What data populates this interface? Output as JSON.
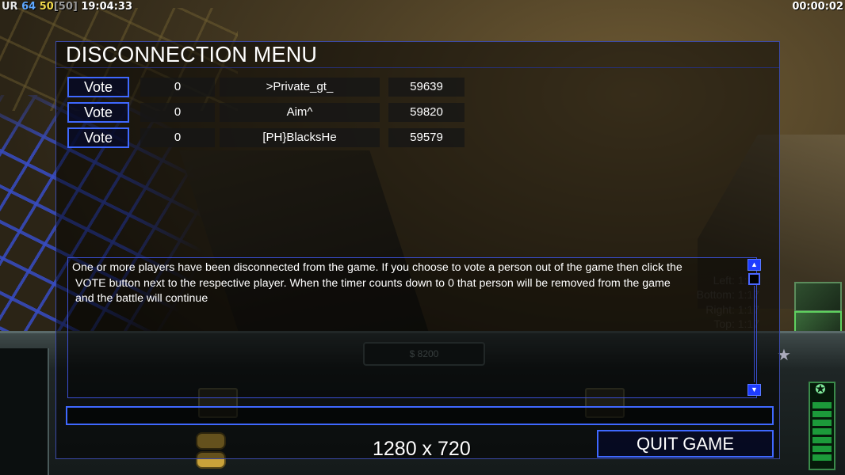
{
  "hud": {
    "left": {
      "label": "UR",
      "value1": "64",
      "value2": "50",
      "value3": "[50]",
      "clock": "19:04:33"
    },
    "game_timer": "00:00:02"
  },
  "dialog": {
    "title": "DISCONNECTION MENU",
    "players": [
      {
        "vote_label": "Vote",
        "votes": "0",
        "name": ">Private_gt_",
        "ping": "59639"
      },
      {
        "vote_label": "Vote",
        "votes": "0",
        "name": "Aim^",
        "ping": "59820"
      },
      {
        "vote_label": "Vote",
        "votes": "0",
        "name": "[PH}BlacksHe",
        "ping": "59579"
      }
    ],
    "message_lines": [
      "One or more players have been disconnected from the game. If you choose to vote a person out of the game then click the",
      "VOTE button next to the respective player. When the timer counts down to 0 that person will be removed from the game",
      "and the battle will continue"
    ],
    "scroll_up_glyph": "▲",
    "scroll_down_glyph": "▼",
    "chat_input_value": "",
    "quit_label": "QUIT GAME"
  },
  "resolution_text": "1280 x 720",
  "background": {
    "money": "$ 8200",
    "timers": [
      "Left: 1:17",
      "Bottom: 1:17",
      "Right: 1:17",
      "Top: 1:17"
    ],
    "icons": {
      "star": "star-icon",
      "power": "power-meter-icon"
    }
  },
  "colors": {
    "dialog_border": "#3b4aa8",
    "button_border": "#3f68ff",
    "scroll_button": "#1e3cff",
    "hud_blue": "#5fa8ff",
    "hud_yellow": "#f0d84a"
  }
}
